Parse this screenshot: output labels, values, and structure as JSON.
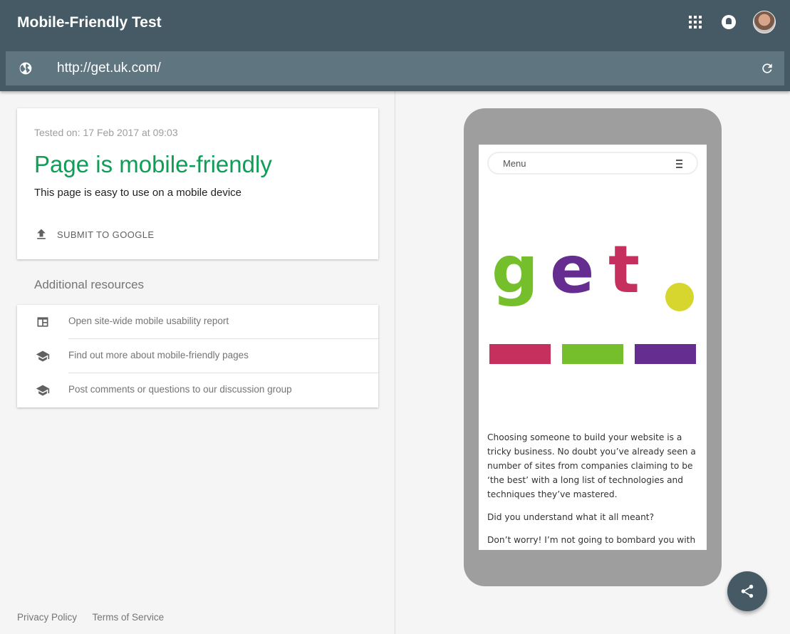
{
  "app": {
    "title": "Mobile-Friendly Test"
  },
  "header": {
    "apps_icon": "apps-grid-icon",
    "notifications_icon": "bell-icon",
    "account_icon": "avatar"
  },
  "urlbar": {
    "url": "http://get.uk.com/",
    "left_icon": "globe-icon",
    "right_icon": "refresh-icon"
  },
  "result": {
    "tested_on": "Tested on: 17 Feb 2017 at 09:03",
    "verdict": "Page is mobile-friendly",
    "description": "This page is easy to use on a mobile device",
    "submit_label": "SUBMIT TO GOOGLE"
  },
  "resources": {
    "title": "Additional resources",
    "items": [
      {
        "label": "Open site-wide mobile usability report",
        "icon": "report-icon"
      },
      {
        "label": "Find out more about mobile-friendly pages",
        "icon": "school-icon"
      },
      {
        "label": "Post comments or questions to our discussion group",
        "icon": "school-icon"
      }
    ]
  },
  "footer": {
    "privacy": "Privacy Policy",
    "terms": "Terms of Service"
  },
  "preview": {
    "menu_label": "Menu",
    "logo_text": "get.",
    "paragraphs": [
      "Choosing someone to build your website is a tricky business. No doubt you’ve already seen a number of sites from companies claiming to be ‘the best’ with a long list of technologies and techniques they’ve mastered.",
      "Did you understand what it all meant?",
      "Don’t worry! I’m not going to bombard you with"
    ]
  },
  "colors": {
    "appbar": "#455a64",
    "urlbar": "#5f7580",
    "success": "#0f9d58",
    "logo_green": "#76bf2c",
    "logo_purple": "#662d91",
    "logo_pink": "#c5305e",
    "logo_yellow": "#d7d62f"
  }
}
